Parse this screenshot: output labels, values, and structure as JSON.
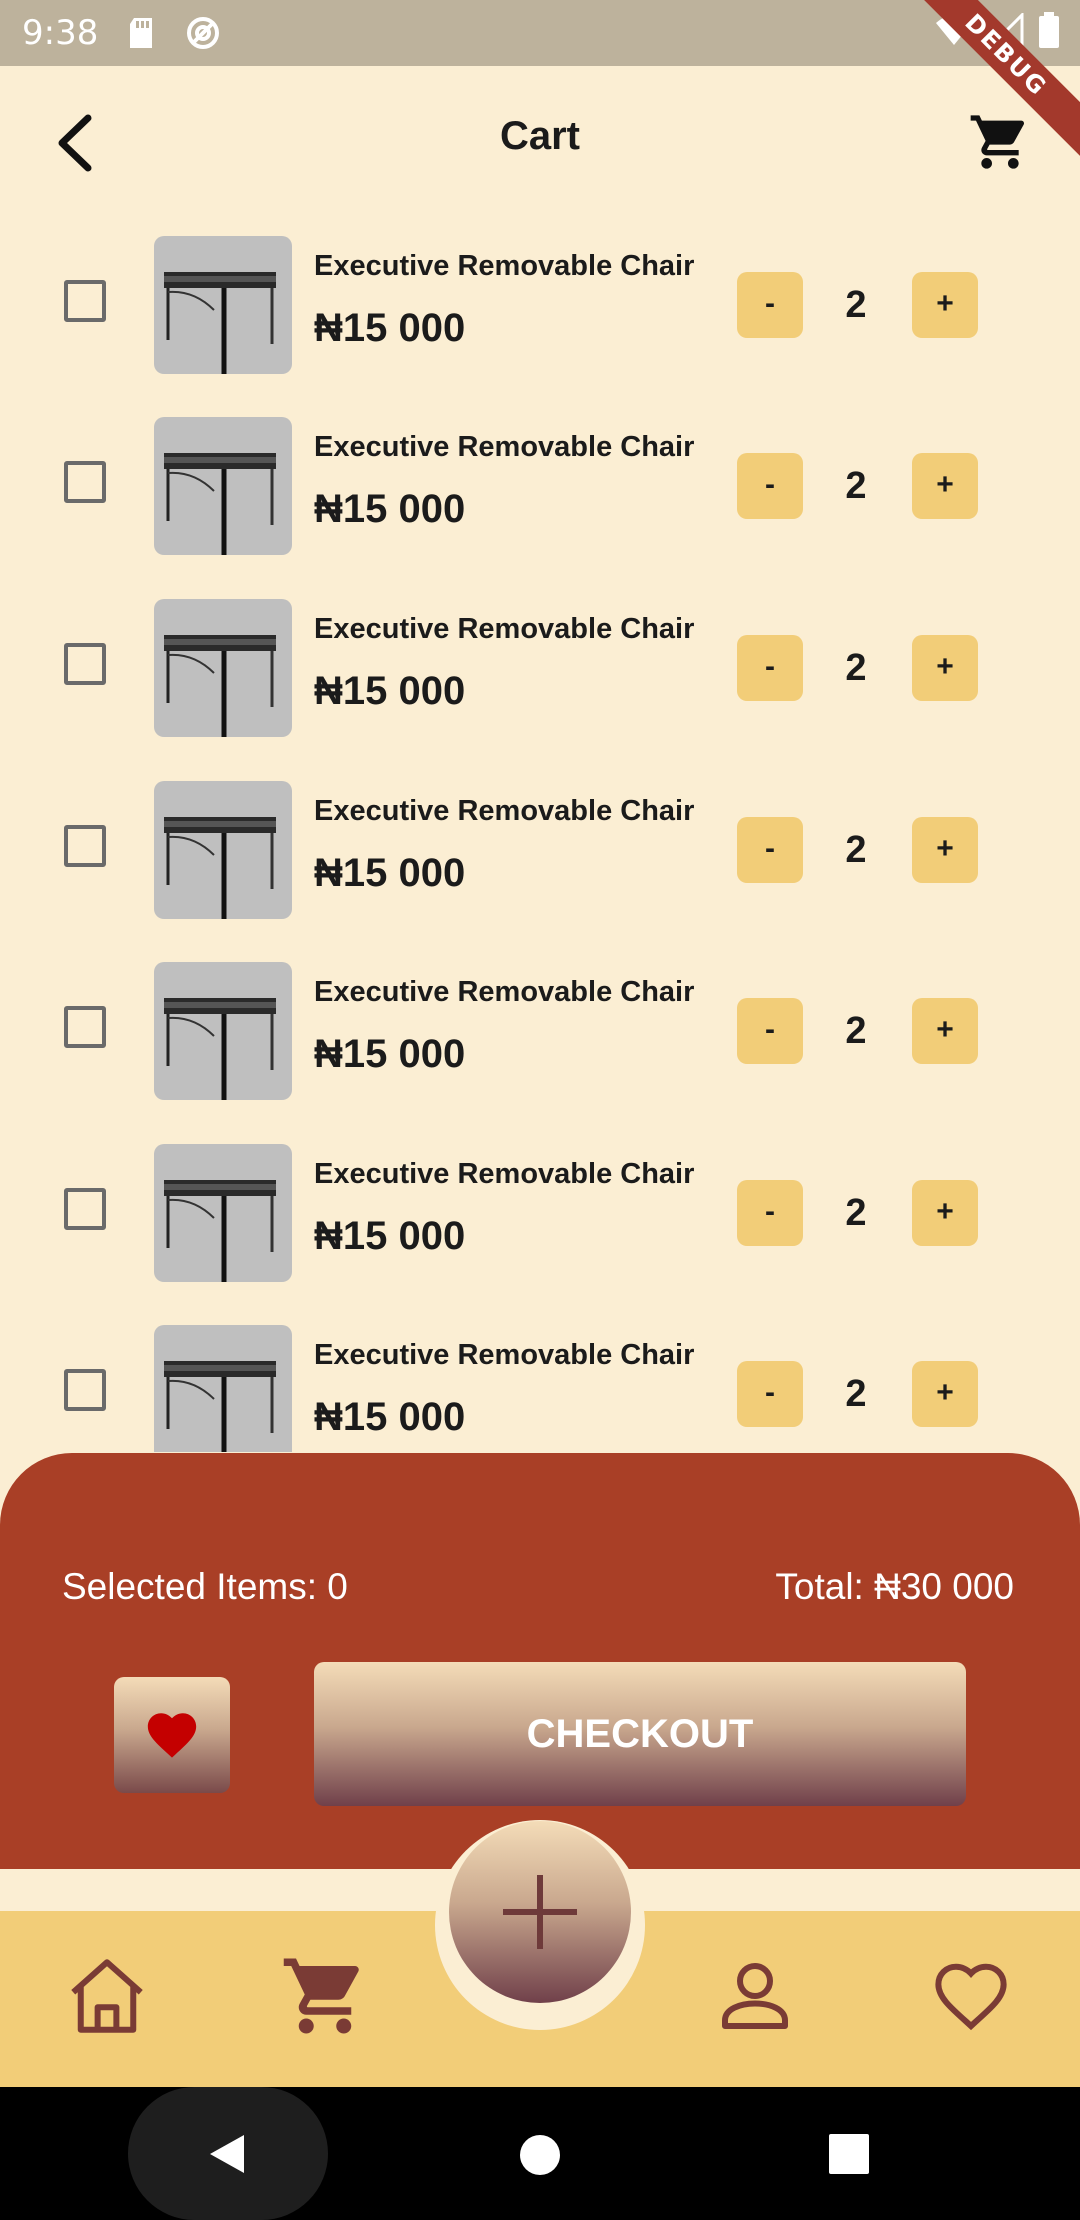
{
  "status_bar": {
    "time": "9:38",
    "debug_label": "DEBUG"
  },
  "header": {
    "title": "Cart"
  },
  "cart": {
    "items": [
      {
        "name": "Executive Removable Chair",
        "price": "₦15 000",
        "minus": "-",
        "qty": "2",
        "plus": "+",
        "checked": false
      },
      {
        "name": "Executive Removable Chair",
        "price": "₦15 000",
        "minus": "-",
        "qty": "2",
        "plus": "+",
        "checked": false
      },
      {
        "name": "Executive Removable Chair",
        "price": "₦15 000",
        "minus": "-",
        "qty": "2",
        "plus": "+",
        "checked": false
      },
      {
        "name": "Executive Removable Chair",
        "price": "₦15 000",
        "minus": "-",
        "qty": "2",
        "plus": "+",
        "checked": false
      },
      {
        "name": "Executive Removable Chair",
        "price": "₦15 000",
        "minus": "-",
        "qty": "2",
        "plus": "+",
        "checked": false
      },
      {
        "name": "Executive Removable Chair",
        "price": "₦15 000",
        "minus": "-",
        "qty": "2",
        "plus": "+",
        "checked": false
      },
      {
        "name": "Executive Removable Chair",
        "price": "₦15 000",
        "minus": "-",
        "qty": "2",
        "plus": "+",
        "checked": false
      }
    ]
  },
  "summary": {
    "selected_items": "Selected Items: 0",
    "total": "Total: ₦30 000",
    "checkout_label": "CHECKOUT"
  },
  "icons": {
    "back": "chevron-left-icon",
    "cart": "cart-icon",
    "favorite": "heart-icon",
    "add": "plus-icon",
    "home": "home-icon",
    "profile": "person-icon",
    "wishlist": "heart-outline-icon"
  },
  "colors": {
    "background": "#fbeed3",
    "accent_panel": "#a93f26",
    "qty_button": "#f2cd78",
    "nav_bar": "#f2cd78",
    "nav_icon": "#7a3b35",
    "heart": "#c40000"
  }
}
